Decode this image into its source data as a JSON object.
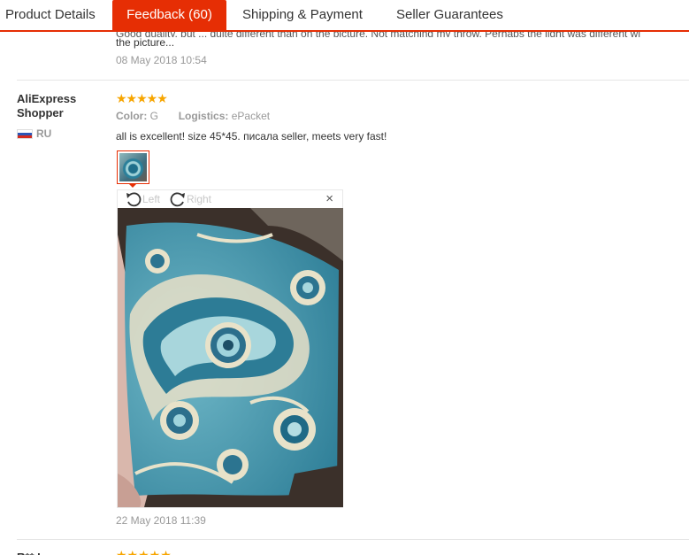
{
  "tabs": [
    {
      "label": "Product Details"
    },
    {
      "label": "Feedback (60)"
    },
    {
      "label": "Shipping & Payment"
    },
    {
      "label": "Seller Guarantees"
    }
  ],
  "prev_review": {
    "text_top": "Good quality, but ... quite different than on the picture. Not matching my throw. Perhaps the light was different wi",
    "text_line": "the picture...",
    "date": "08 May 2018 10:54"
  },
  "review": {
    "user_name": "AliExpress Shopper",
    "country": "RU",
    "rating": "★★★★★",
    "color_label": "Color:",
    "color_value": "G",
    "logistics_label": "Logistics:",
    "logistics_value": "ePacket",
    "text": "all is excellent! size 45*45. писала seller, meets very fast!",
    "viewer": {
      "rotate_left": "Left",
      "rotate_right": "Right",
      "close": "×"
    },
    "date": "22 May 2018 11:39"
  },
  "next_review": {
    "user_name": "R** L",
    "rating": "★★★★★"
  },
  "colors": {
    "accent": "#e62e04",
    "star": "#f7a500",
    "muted": "#999999"
  }
}
